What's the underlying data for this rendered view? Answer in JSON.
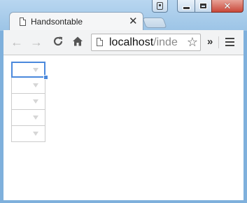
{
  "window": {
    "caption_buttons": {
      "user": "user-icon",
      "minimize": "minimize-icon",
      "maximize": "maximize-icon",
      "close": "✕"
    },
    "colors": {
      "frame": "#9cc4e6",
      "close": "#c9483a",
      "selection": "#4b89dc"
    }
  },
  "tab": {
    "title": "Handsontable",
    "close_glyph": "✕"
  },
  "toolbar": {
    "back_glyph": "←",
    "forward_glyph": "→",
    "reload_glyph": "C",
    "home_glyph": "⌂",
    "url_host": "localhost",
    "url_rest": "/inde",
    "star_glyph": "☆",
    "overflow_glyph": "»"
  },
  "table": {
    "rows": [
      "",
      "",
      "",
      "",
      ""
    ],
    "selected_row": 0
  }
}
